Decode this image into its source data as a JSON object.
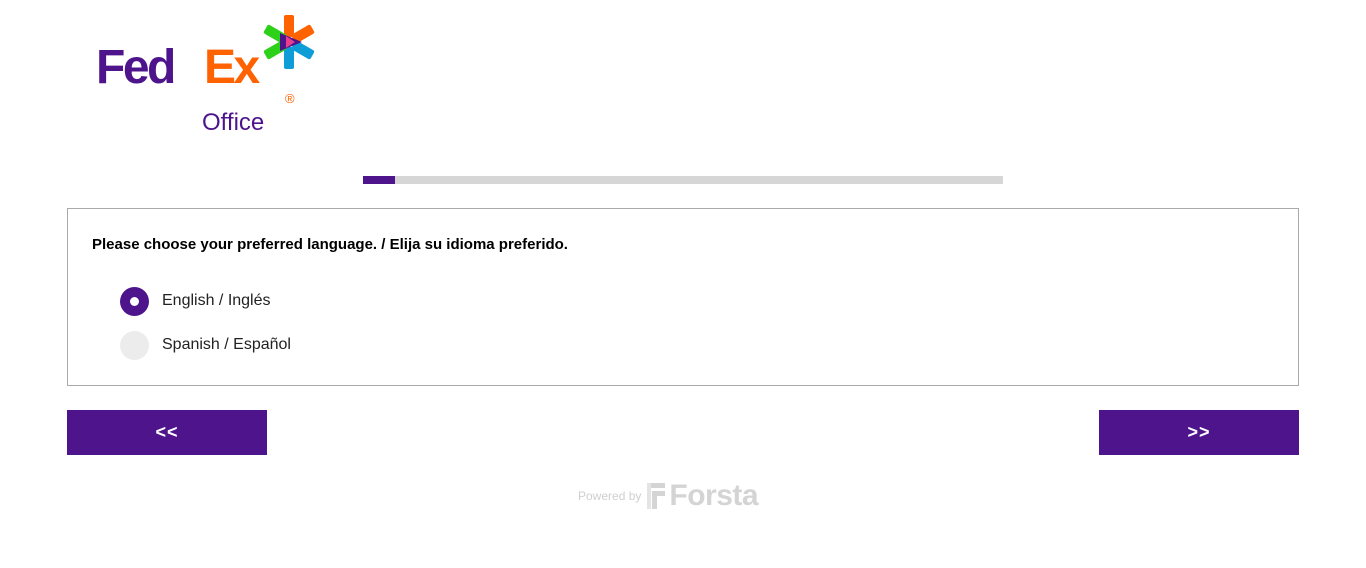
{
  "logo": {
    "fed": "Fed",
    "ex": "Ex",
    "registered": "®",
    "office": "Office",
    "colors": {
      "purple": "#4d148c",
      "orange": "#ff6200",
      "green": "#2ed11a",
      "blue": "#0e9dd6",
      "pink": "#e83e8c"
    }
  },
  "progress": {
    "percent": 5
  },
  "question": {
    "text": "Please choose your preferred language. / Elija su idioma preferido.",
    "options": [
      {
        "label": "English / Inglés",
        "selected": true
      },
      {
        "label": "Spanish / Español",
        "selected": false
      }
    ]
  },
  "nav": {
    "back_label": "<<",
    "next_label": ">>"
  },
  "footer": {
    "powered_by": "Powered by",
    "brand": "Forsta"
  },
  "colors": {
    "accent": "#4d148c",
    "progress_track": "#d6d6d6",
    "radio_unselected": "#ececec"
  }
}
